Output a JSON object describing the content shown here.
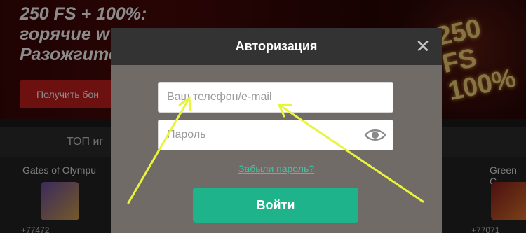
{
  "background": {
    "hero_title": "250 FS + 100%:\nгорячие w\nРазожгите",
    "promo_button": "Получить бон",
    "promo_art_text": "250 FS\n100%",
    "top_strip": "ТОП иг",
    "games": [
      {
        "name": "Gates of Olympu",
        "count": "+77472"
      },
      {
        "name": "Green C",
        "count": "+77071"
      }
    ]
  },
  "modal": {
    "title": "Авторизация",
    "close_symbol": "✕",
    "login_placeholder": "Ваш телефон/e-mail",
    "password_placeholder": "Пароль",
    "forgot_link": "Забыли пароль?",
    "submit_label": "Войти"
  },
  "colors": {
    "accent": "#1fb38b",
    "link": "#45c2a6",
    "arrow": "#e8f53b",
    "modal_header": "#333333",
    "modal_body": "#706b66"
  },
  "icons": {
    "close": "close-icon",
    "eye": "eye-icon"
  }
}
